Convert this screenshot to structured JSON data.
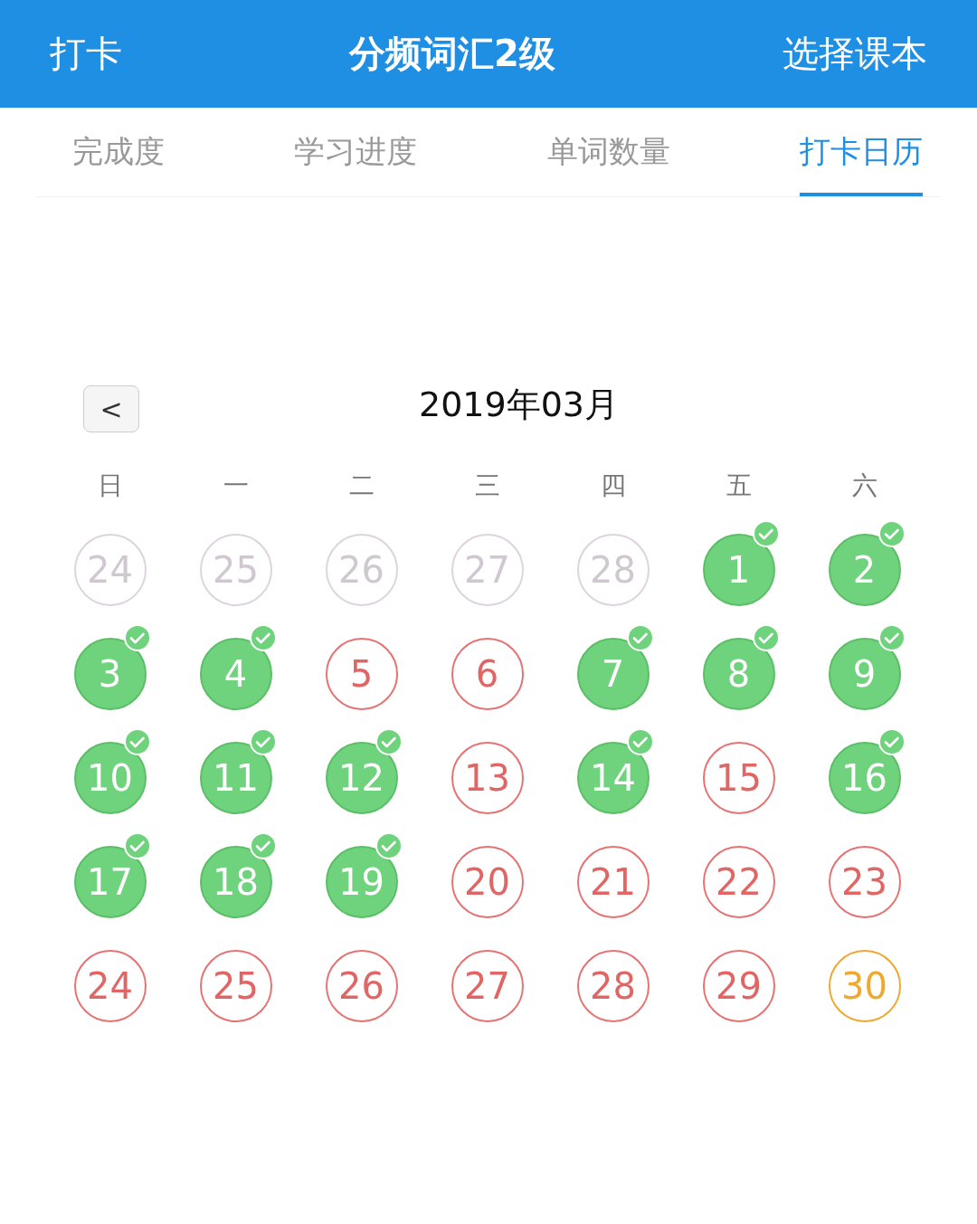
{
  "header": {
    "left": "打卡",
    "title": "分频词汇2级",
    "right": "选择课本"
  },
  "tabs": [
    {
      "label": "完成度",
      "selected": false
    },
    {
      "label": "学习进度",
      "selected": false
    },
    {
      "label": "单词数量",
      "selected": false
    },
    {
      "label": "打卡日历",
      "selected": true
    }
  ],
  "calendar": {
    "back": "<",
    "month": "2019年03月",
    "weekdays": [
      "日",
      "一",
      "二",
      "三",
      "四",
      "五",
      "六"
    ],
    "weeks": [
      [
        {
          "day": "24",
          "other_month": true,
          "checked_in": false,
          "today": false
        },
        {
          "day": "25",
          "other_month": true,
          "checked_in": false,
          "today": false
        },
        {
          "day": "26",
          "other_month": true,
          "checked_in": false,
          "today": false
        },
        {
          "day": "27",
          "other_month": true,
          "checked_in": false,
          "today": false
        },
        {
          "day": "28",
          "other_month": true,
          "checked_in": false,
          "today": false
        },
        {
          "day": "1",
          "other_month": false,
          "checked_in": true,
          "today": false
        },
        {
          "day": "2",
          "other_month": false,
          "checked_in": true,
          "today": false
        }
      ],
      [
        {
          "day": "3",
          "other_month": false,
          "checked_in": true,
          "today": false
        },
        {
          "day": "4",
          "other_month": false,
          "checked_in": true,
          "today": false
        },
        {
          "day": "5",
          "other_month": false,
          "checked_in": false,
          "today": false
        },
        {
          "day": "6",
          "other_month": false,
          "checked_in": false,
          "today": false
        },
        {
          "day": "7",
          "other_month": false,
          "checked_in": true,
          "today": false
        },
        {
          "day": "8",
          "other_month": false,
          "checked_in": true,
          "today": false
        },
        {
          "day": "9",
          "other_month": false,
          "checked_in": true,
          "today": false
        }
      ],
      [
        {
          "day": "10",
          "other_month": false,
          "checked_in": true,
          "today": false
        },
        {
          "day": "11",
          "other_month": false,
          "checked_in": true,
          "today": false
        },
        {
          "day": "12",
          "other_month": false,
          "checked_in": true,
          "today": false
        },
        {
          "day": "13",
          "other_month": false,
          "checked_in": false,
          "today": false
        },
        {
          "day": "14",
          "other_month": false,
          "checked_in": true,
          "today": false
        },
        {
          "day": "15",
          "other_month": false,
          "checked_in": false,
          "today": false
        },
        {
          "day": "16",
          "other_month": false,
          "checked_in": true,
          "today": false
        }
      ],
      [
        {
          "day": "17",
          "other_month": false,
          "checked_in": true,
          "today": false
        },
        {
          "day": "18",
          "other_month": false,
          "checked_in": true,
          "today": false
        },
        {
          "day": "19",
          "other_month": false,
          "checked_in": true,
          "today": false
        },
        {
          "day": "20",
          "other_month": false,
          "checked_in": false,
          "today": false
        },
        {
          "day": "21",
          "other_month": false,
          "checked_in": false,
          "today": false
        },
        {
          "day": "22",
          "other_month": false,
          "checked_in": false,
          "today": false
        },
        {
          "day": "23",
          "other_month": false,
          "checked_in": false,
          "today": false
        }
      ],
      [
        {
          "day": "24",
          "other_month": false,
          "checked_in": false,
          "today": false
        },
        {
          "day": "25",
          "other_month": false,
          "checked_in": false,
          "today": false
        },
        {
          "day": "26",
          "other_month": false,
          "checked_in": false,
          "today": false
        },
        {
          "day": "27",
          "other_month": false,
          "checked_in": false,
          "today": false
        },
        {
          "day": "28",
          "other_month": false,
          "checked_in": false,
          "today": false
        },
        {
          "day": "29",
          "other_month": false,
          "checked_in": false,
          "today": false
        },
        {
          "day": "30",
          "other_month": false,
          "checked_in": false,
          "today": true
        }
      ]
    ]
  }
}
